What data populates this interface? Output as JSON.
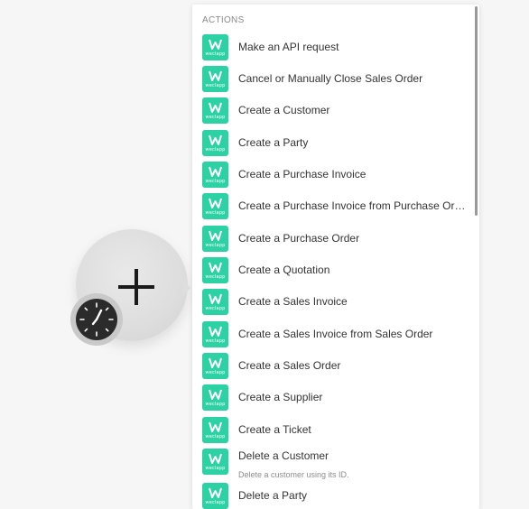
{
  "panel": {
    "section_title": "ACTIONS",
    "items": [
      {
        "label": "Make an API request",
        "icon": "weclapp-logo-icon",
        "desc": ""
      },
      {
        "label": "Cancel or Manually Close Sales Order",
        "icon": "weclapp-logo-icon",
        "desc": ""
      },
      {
        "label": "Create a Customer",
        "icon": "weclapp-logo-icon",
        "desc": ""
      },
      {
        "label": "Create a Party",
        "icon": "weclapp-logo-icon",
        "desc": ""
      },
      {
        "label": "Create a Purchase Invoice",
        "icon": "weclapp-logo-icon",
        "desc": ""
      },
      {
        "label": "Create a Purchase Invoice from Purchase Ord...",
        "icon": "weclapp-logo-icon",
        "desc": ""
      },
      {
        "label": "Create a Purchase Order",
        "icon": "weclapp-logo-icon",
        "desc": ""
      },
      {
        "label": "Create a Quotation",
        "icon": "weclapp-logo-icon",
        "desc": ""
      },
      {
        "label": "Create a Sales Invoice",
        "icon": "weclapp-logo-icon",
        "desc": ""
      },
      {
        "label": "Create a Sales Invoice from Sales Order",
        "icon": "weclapp-logo-icon",
        "desc": ""
      },
      {
        "label": "Create a Sales Order",
        "icon": "weclapp-logo-icon",
        "desc": ""
      },
      {
        "label": "Create a Supplier",
        "icon": "weclapp-logo-icon",
        "desc": ""
      },
      {
        "label": "Create a Ticket",
        "icon": "weclapp-logo-icon",
        "desc": ""
      },
      {
        "label": "Delete a Customer",
        "icon": "weclapp-logo-icon",
        "desc": "Delete a customer using its ID."
      },
      {
        "label": "Delete a Party",
        "icon": "weclapp-logo-icon",
        "desc": ""
      }
    ],
    "icon_caption": "weclapp"
  },
  "module": {
    "main_icon": "plus-icon",
    "badge_icon": "clock-icon"
  },
  "colors": {
    "app_accent": "#2dd2a4",
    "background": "#f6f6f6"
  }
}
